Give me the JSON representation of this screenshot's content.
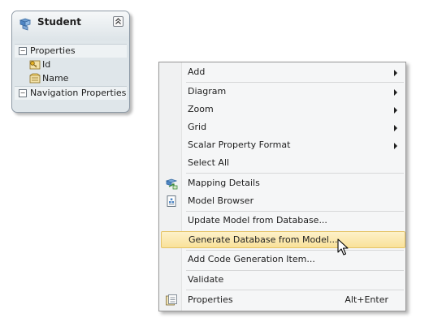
{
  "entity": {
    "title": "Student",
    "properties_header": "Properties",
    "properties": [
      "Id",
      "Name"
    ],
    "navigation_header": "Navigation Properties"
  },
  "menu": {
    "items": [
      {
        "label": "Add",
        "submenu": true
      },
      {
        "label": "Diagram",
        "submenu": true
      },
      {
        "label": "Zoom",
        "submenu": true
      },
      {
        "label": "Grid",
        "submenu": true
      },
      {
        "label": "Scalar Property Format",
        "submenu": true
      },
      {
        "label": "Select All"
      },
      {
        "label": "Mapping Details",
        "icon": "mapping-details-icon"
      },
      {
        "label": "Model Browser",
        "icon": "model-browser-icon"
      },
      {
        "label": "Update Model from Database..."
      },
      {
        "label": "Generate Database from Model...",
        "highlighted": true
      },
      {
        "label": "Add Code Generation Item..."
      },
      {
        "label": "Validate"
      },
      {
        "label": "Properties",
        "shortcut": "Alt+Enter",
        "icon": "properties-icon"
      }
    ]
  },
  "colors": {
    "highlight": "#f9e199",
    "entity_fill": "#dfe6ea"
  }
}
